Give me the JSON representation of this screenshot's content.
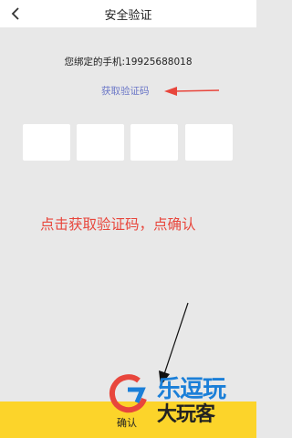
{
  "header": {
    "back_icon": "chevron-left-icon",
    "title": "安全验证"
  },
  "verification": {
    "phone_text": "您绑定的手机:19925688018",
    "get_code_label": "获取验证码",
    "code_box_count": 4
  },
  "annotation": {
    "instruction": "点击获取验证码，点确认",
    "arrow_color": "#e8463c"
  },
  "footer": {
    "confirm_label": "确认",
    "button_color": "#fcd42a"
  },
  "watermark": {
    "text_line1": "乐逗玩",
    "text_line2": "大玩客"
  }
}
